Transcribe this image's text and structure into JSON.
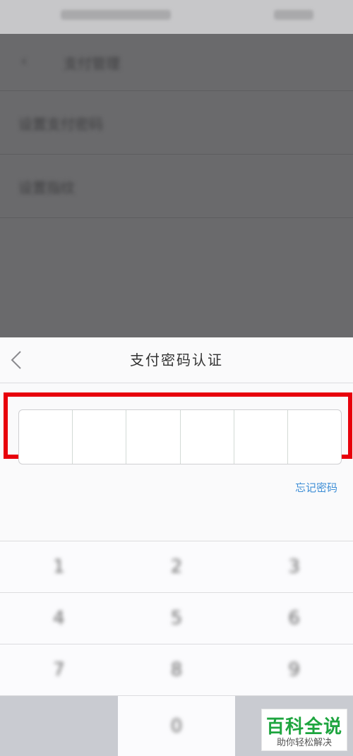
{
  "background_page": {
    "header_title": "支付管理",
    "row1": "设置支付密码",
    "row2": "设置指纹"
  },
  "sheet": {
    "title": "支付密码认证",
    "back_icon": "chevron-left-icon",
    "pin_length": 6,
    "forgot_label": "忘记密码"
  },
  "keypad": {
    "row1": [
      "1",
      "2",
      "3"
    ],
    "row2": [
      "4",
      "5",
      "6"
    ],
    "row3": [
      "7",
      "8",
      "9"
    ],
    "row4": [
      "",
      "0",
      ""
    ]
  },
  "watermark": {
    "title": "百科全说",
    "subtitle": "助你轻松解决"
  },
  "colors": {
    "highlight": "#e8000c",
    "link": "#3e8ed6",
    "watermark_green": "#1ea53f"
  }
}
